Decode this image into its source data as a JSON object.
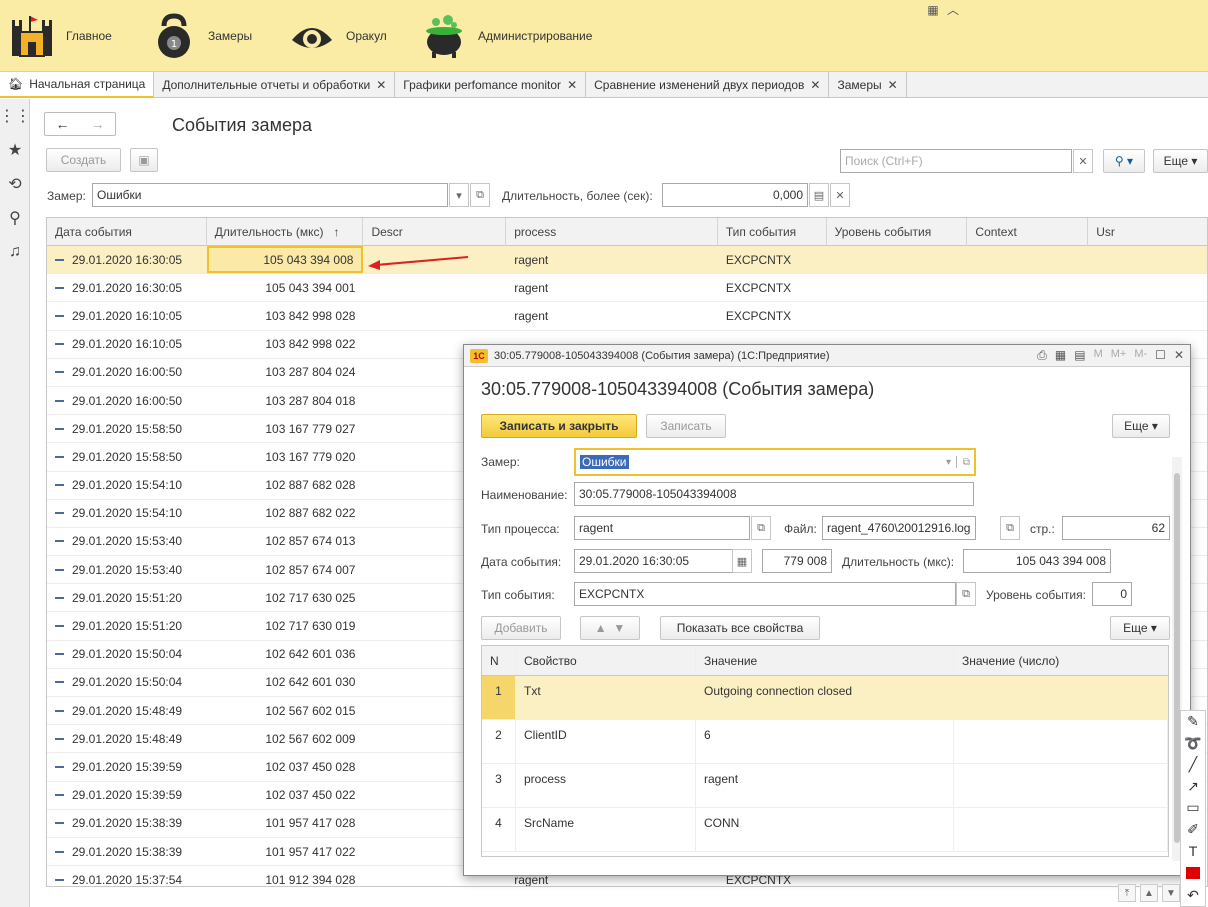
{
  "sections": [
    {
      "label": "Главное",
      "icon": "castle-icon"
    },
    {
      "label": "Замеры",
      "icon": "kettlebell-icon"
    },
    {
      "label": "Оракул",
      "icon": "eye-icon"
    },
    {
      "label": "Администрирование",
      "icon": "cauldron-icon"
    }
  ],
  "tabs": [
    {
      "label": "Начальная страница",
      "icon": "home-icon"
    },
    {
      "label": "Дополнительные отчеты и обработки"
    },
    {
      "label": "Графики perfomance monitor"
    },
    {
      "label": "Сравнение изменений двух периодов"
    },
    {
      "label": "Замеры"
    }
  ],
  "form": {
    "title": "События замера",
    "create_label": "Создать",
    "search_placeholder": "Поиск (Ctrl+F)",
    "more_label": "Еще",
    "zamer_label": "Замер:",
    "zamer_value": "Ошибки",
    "duration_label": "Длительность, более (сек):",
    "duration_value": "0,000"
  },
  "table": {
    "columns": [
      "Дата события",
      "Длительность (мкс)",
      "Descr",
      "process",
      "Тип события",
      "Уровень события",
      "Context",
      "Usr"
    ],
    "sort_indicator": "↑",
    "rows": [
      {
        "date": "29.01.2020 16:30:05",
        "duration": "105 043 394 008",
        "process": "ragent",
        "type": "EXCPCNTX"
      },
      {
        "date": "29.01.2020 16:30:05",
        "duration": "105 043 394 001",
        "process": "ragent",
        "type": "EXCPCNTX"
      },
      {
        "date": "29.01.2020 16:10:05",
        "duration": "103 842 998 028",
        "process": "ragent",
        "type": "EXCPCNTX"
      },
      {
        "date": "29.01.2020 16:10:05",
        "duration": "103 842 998 022",
        "process": "",
        "type": ""
      },
      {
        "date": "29.01.2020 16:00:50",
        "duration": "103 287 804 024",
        "process": "",
        "type": ""
      },
      {
        "date": "29.01.2020 16:00:50",
        "duration": "103 287 804 018",
        "process": "",
        "type": ""
      },
      {
        "date": "29.01.2020 15:58:50",
        "duration": "103 167 779 027",
        "process": "",
        "type": ""
      },
      {
        "date": "29.01.2020 15:58:50",
        "duration": "103 167 779 020",
        "process": "",
        "type": ""
      },
      {
        "date": "29.01.2020 15:54:10",
        "duration": "102 887 682 028",
        "process": "",
        "type": ""
      },
      {
        "date": "29.01.2020 15:54:10",
        "duration": "102 887 682 022",
        "process": "",
        "type": ""
      },
      {
        "date": "29.01.2020 15:53:40",
        "duration": "102 857 674 013",
        "process": "",
        "type": ""
      },
      {
        "date": "29.01.2020 15:53:40",
        "duration": "102 857 674 007",
        "process": "",
        "type": ""
      },
      {
        "date": "29.01.2020 15:51:20",
        "duration": "102 717 630 025",
        "process": "",
        "type": ""
      },
      {
        "date": "29.01.2020 15:51:20",
        "duration": "102 717 630 019",
        "process": "",
        "type": ""
      },
      {
        "date": "29.01.2020 15:50:04",
        "duration": "102 642 601 036",
        "process": "",
        "type": ""
      },
      {
        "date": "29.01.2020 15:50:04",
        "duration": "102 642 601 030",
        "process": "",
        "type": ""
      },
      {
        "date": "29.01.2020 15:48:49",
        "duration": "102 567 602 015",
        "process": "",
        "type": ""
      },
      {
        "date": "29.01.2020 15:48:49",
        "duration": "102 567 602 009",
        "process": "",
        "type": ""
      },
      {
        "date": "29.01.2020 15:39:59",
        "duration": "102 037 450 028",
        "process": "",
        "type": ""
      },
      {
        "date": "29.01.2020 15:39:59",
        "duration": "102 037 450 022",
        "process": "",
        "type": ""
      },
      {
        "date": "29.01.2020 15:38:39",
        "duration": "101 957 417 028",
        "process": "",
        "type": ""
      },
      {
        "date": "29.01.2020 15:38:39",
        "duration": "101 957 417 022",
        "process": "",
        "type": ""
      },
      {
        "date": "29.01.2020 15:37:54",
        "duration": "101 912 394 028",
        "process": "ragent",
        "type": "EXCPCNTX"
      }
    ]
  },
  "dialog": {
    "window_title": "30:05.779008-105043394008 (События замера)  (1С:Предприятие)",
    "logo": "1С",
    "win_buttons": [
      "M",
      "M+",
      "M-"
    ],
    "heading": "30:05.779008-105043394008 (События замера)",
    "save_close_label": "Записать и закрыть",
    "save_label": "Записать",
    "more_label": "Еще",
    "zamer_label": "Замер:",
    "zamer_value": "Ошибки",
    "name_label": "Наименование:",
    "name_value": "30:05.779008-105043394008",
    "process_type_label": "Тип процесса:",
    "process_type_value": "ragent",
    "file_label": "Файл:",
    "file_value": "ragent_4760\\20012916.log",
    "line_label": "стр.:",
    "line_value": "62",
    "event_date_label": "Дата события:",
    "event_date_value": "29.01.2020 16:30:05",
    "microsec_value": "779 008",
    "duration_label": "Длительность (мкс):",
    "duration_value": "105 043 394 008",
    "event_type_label": "Тип события:",
    "event_type_value": "EXCPCNTX",
    "event_level_label": "Уровень события:",
    "event_level_value": "0",
    "add_label": "Добавить",
    "show_all_label": "Показать все свойства",
    "more2_label": "Еще",
    "props_columns": [
      "N",
      "Свойство",
      "Значение",
      "Значение (число)"
    ],
    "props": [
      {
        "n": "1",
        "name": "Txt",
        "value": "Outgoing connection closed",
        "num": ""
      },
      {
        "n": "2",
        "name": "ClientID",
        "value": "6",
        "num": ""
      },
      {
        "n": "3",
        "name": "process",
        "value": "ragent",
        "num": ""
      },
      {
        "n": "4",
        "name": "SrcName",
        "value": "CONN",
        "num": ""
      }
    ]
  },
  "colors": {
    "accent_yellow": "#f0c030",
    "topbar_bg": "#fbeca5",
    "selection_bg": "#fbf0c3",
    "annotation_arrow": "#e02020"
  }
}
